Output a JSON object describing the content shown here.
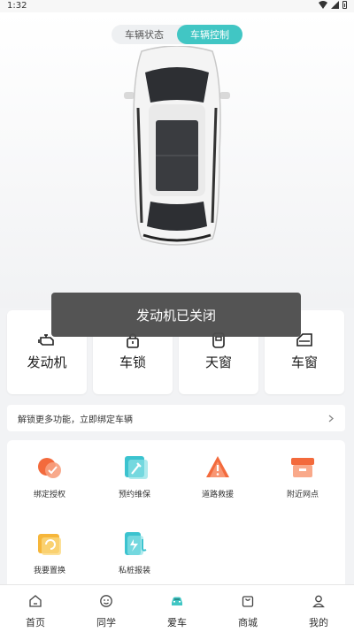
{
  "status_bar": {
    "time": "1:32"
  },
  "segmented": {
    "tabs": [
      {
        "label": "车辆状态"
      },
      {
        "label": "车辆控制"
      }
    ],
    "active_index": 1
  },
  "controls": [
    {
      "label": "发动机",
      "icon": "engine-icon"
    },
    {
      "label": "车锁",
      "icon": "lock-icon"
    },
    {
      "label": "天窗",
      "icon": "sunroof-icon"
    },
    {
      "label": "车窗",
      "icon": "window-icon"
    }
  ],
  "toast": {
    "message": "发动机已关闭"
  },
  "bind_bar": {
    "text": "解锁更多功能，立即绑定车辆"
  },
  "services": [
    {
      "label": "绑定授权",
      "icon": "bind-authorize-icon"
    },
    {
      "label": "预约维保",
      "icon": "maintenance-icon"
    },
    {
      "label": "道路救援",
      "icon": "road-rescue-icon"
    },
    {
      "label": "附近网点",
      "icon": "nearby-store-icon"
    },
    {
      "label": "我要置换",
      "icon": "trade-in-icon"
    },
    {
      "label": "私桩报装",
      "icon": "charger-install-icon"
    }
  ],
  "tabbar": {
    "items": [
      {
        "label": "首页",
        "icon": "home-icon"
      },
      {
        "label": "同学",
        "icon": "classmates-icon"
      },
      {
        "label": "爱车",
        "icon": "car-icon"
      },
      {
        "label": "商城",
        "icon": "mall-icon"
      },
      {
        "label": "我的",
        "icon": "profile-icon"
      }
    ],
    "active_index": 2
  },
  "colors": {
    "accent": "#41c6c4",
    "service_orange": "#f36a3c",
    "service_teal": "#3cc3cf"
  }
}
